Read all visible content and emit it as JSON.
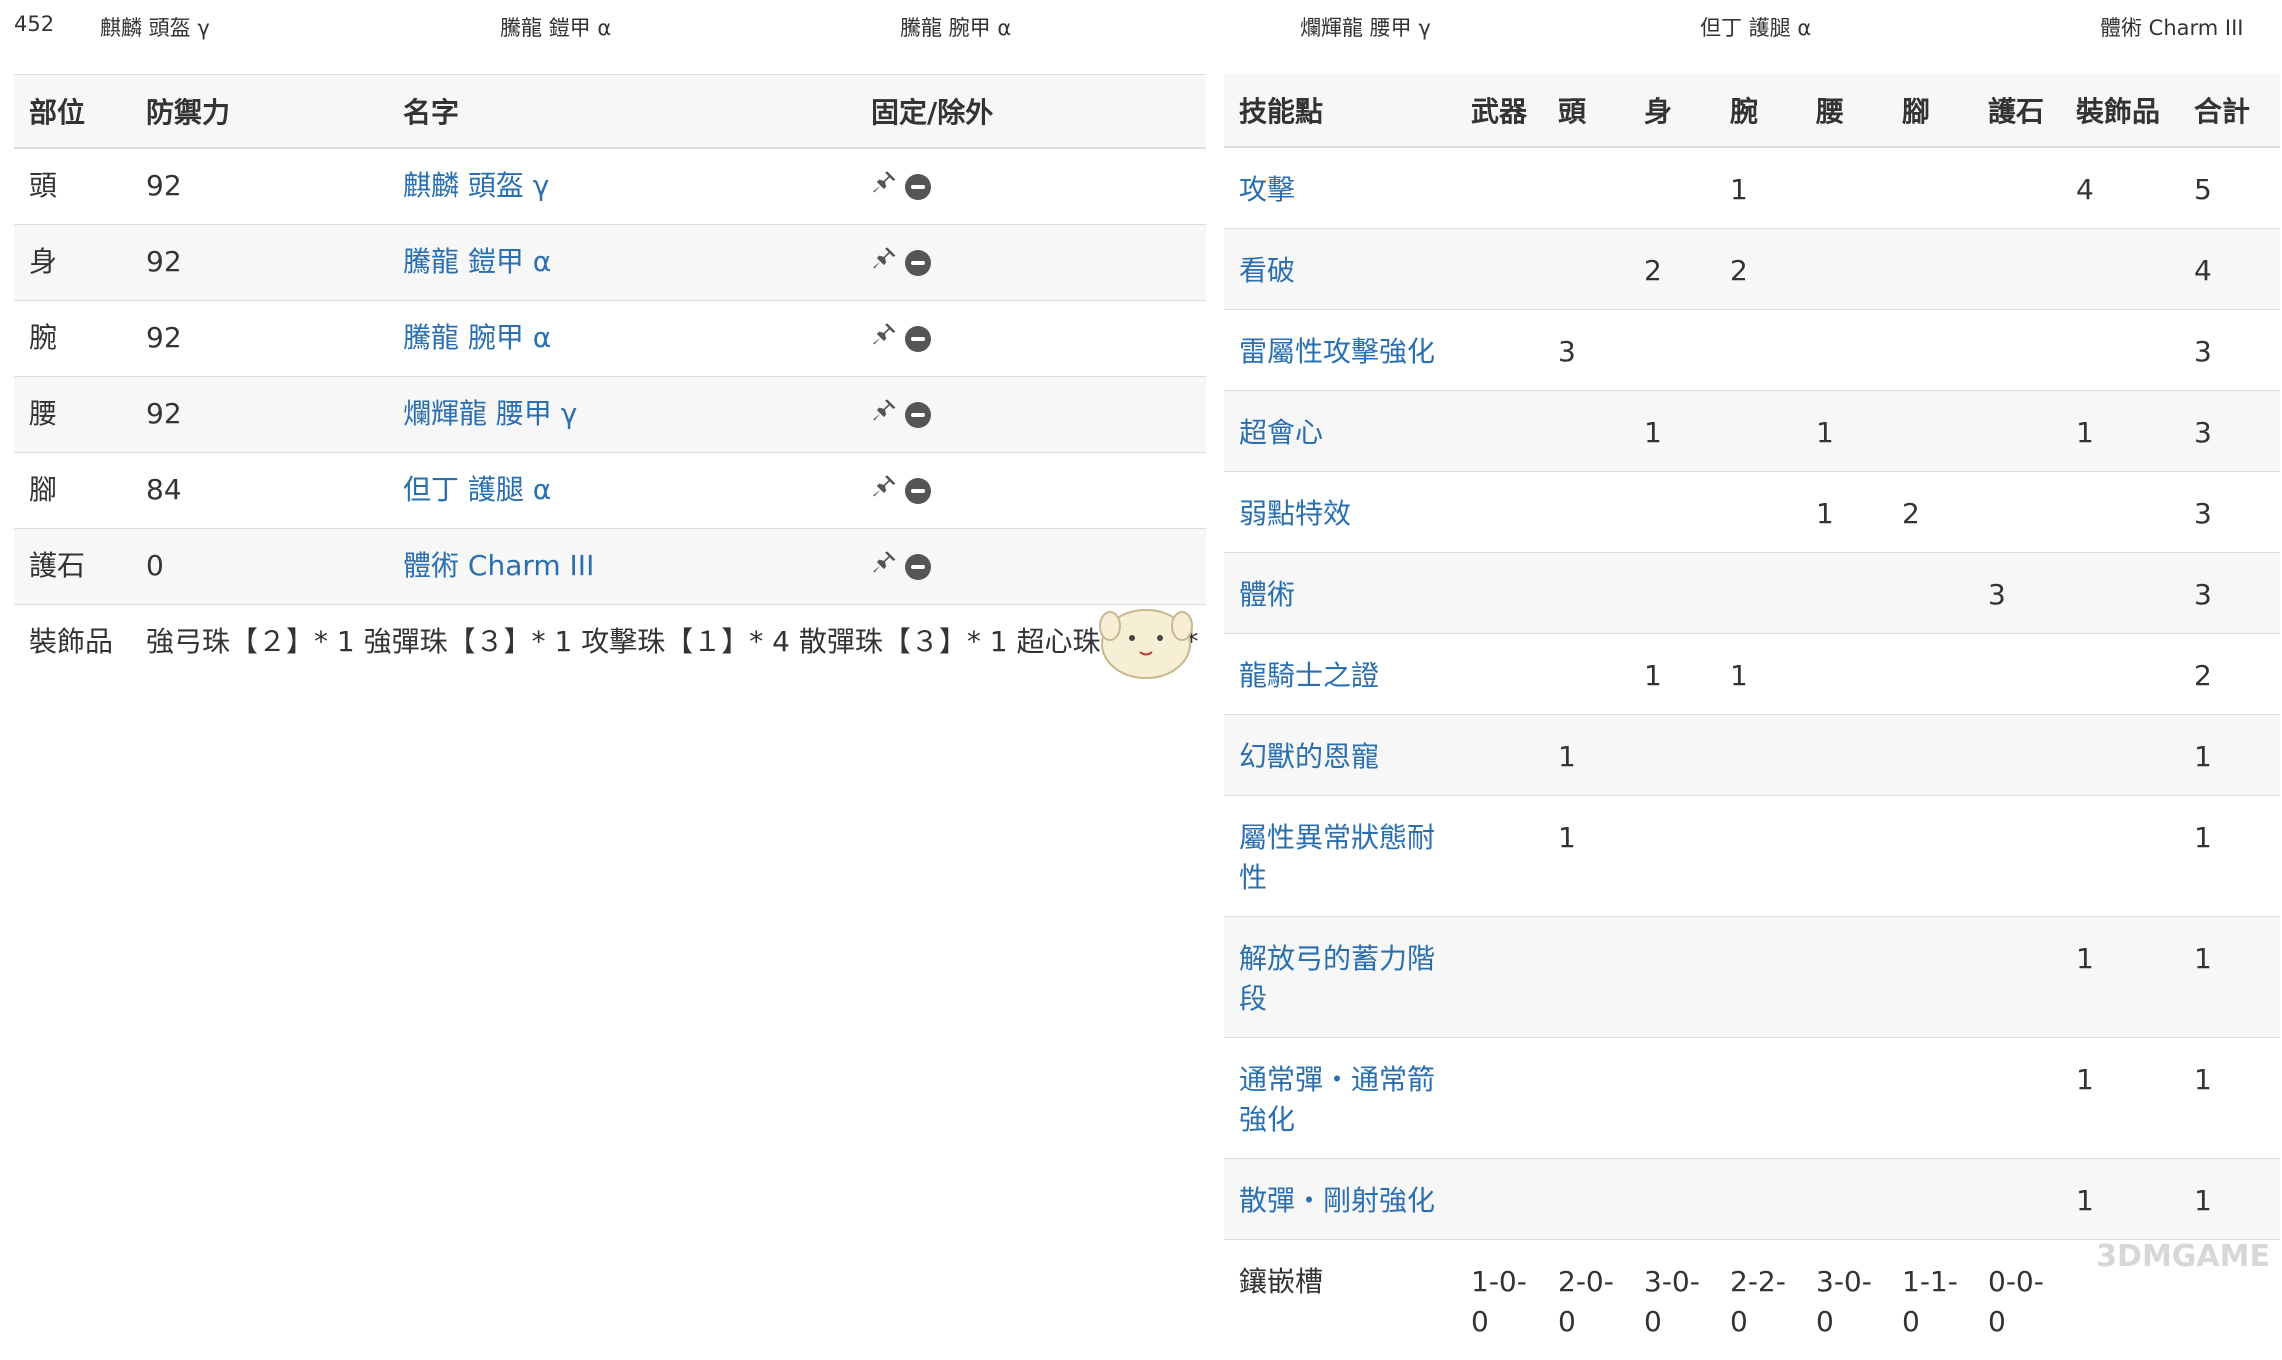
{
  "top_bar": {
    "score": "452",
    "pieces": [
      "麒麟 頭盔 γ",
      "騰龍 鎧甲 α",
      "騰龍 腕甲 α",
      "爛輝龍 腰甲 γ",
      "但丁 護腿 α",
      "體術 Charm III"
    ]
  },
  "equipment": {
    "headers": [
      "部位",
      "防禦力",
      "名字",
      "固定/除外"
    ],
    "rows": [
      {
        "slot": "頭",
        "defense": "92",
        "name": "麒麟 頭盔 γ"
      },
      {
        "slot": "身",
        "defense": "92",
        "name": "騰龍 鎧甲 α"
      },
      {
        "slot": "腕",
        "defense": "92",
        "name": "騰龍 腕甲 α"
      },
      {
        "slot": "腰",
        "defense": "92",
        "name": "爛輝龍 腰甲 γ"
      },
      {
        "slot": "腳",
        "defense": "84",
        "name": "但丁 護腿 α"
      },
      {
        "slot": "護石",
        "defense": "0",
        "name": "體術 Charm III"
      }
    ],
    "decorations_label": "裝飾品",
    "decorations_value": "強弓珠【２】* 1 強彈珠【３】* 1 攻擊珠【１】* 4 散彈珠【３】* 1 超心珠【２】* 1"
  },
  "skills": {
    "headers": [
      "技能點",
      "武器",
      "頭",
      "身",
      "腕",
      "腰",
      "腳",
      "護石",
      "裝飾品",
      "合計"
    ],
    "rows": [
      {
        "skill": "攻擊",
        "values": [
          "",
          "",
          "",
          "1",
          "",
          "",
          "",
          "4",
          "5"
        ]
      },
      {
        "skill": "看破",
        "values": [
          "",
          "",
          "2",
          "2",
          "",
          "",
          "",
          "",
          "4"
        ]
      },
      {
        "skill": "雷屬性攻擊強化",
        "values": [
          "",
          "3",
          "",
          "",
          "",
          "",
          "",
          "",
          "3"
        ]
      },
      {
        "skill": "超會心",
        "values": [
          "",
          "",
          "1",
          "",
          "1",
          "",
          "",
          "1",
          "3"
        ]
      },
      {
        "skill": "弱點特效",
        "values": [
          "",
          "",
          "",
          "",
          "1",
          "2",
          "",
          "",
          "3"
        ]
      },
      {
        "skill": "體術",
        "values": [
          "",
          "",
          "",
          "",
          "",
          "",
          "3",
          "",
          "3"
        ]
      },
      {
        "skill": "龍騎士之證",
        "values": [
          "",
          "",
          "1",
          "1",
          "",
          "",
          "",
          "",
          "2"
        ]
      },
      {
        "skill": "幻獸的恩寵",
        "values": [
          "",
          "1",
          "",
          "",
          "",
          "",
          "",
          "",
          "1"
        ]
      },
      {
        "skill": "屬性異常狀態耐性",
        "values": [
          "",
          "1",
          "",
          "",
          "",
          "",
          "",
          "",
          "1"
        ]
      },
      {
        "skill": "解放弓的蓄力階段",
        "values": [
          "",
          "",
          "",
          "",
          "",
          "",
          "",
          "1",
          "1"
        ]
      },
      {
        "skill": "通常彈・通常箭強化",
        "values": [
          "",
          "",
          "",
          "",
          "",
          "",
          "",
          "1",
          "1"
        ]
      },
      {
        "skill": "散彈・剛射強化",
        "values": [
          "",
          "",
          "",
          "",
          "",
          "",
          "",
          "1",
          "1"
        ]
      }
    ],
    "slots_label": "鑲嵌槽",
    "slots_values": [
      "1-0-0",
      "2-0-0",
      "3-0-0",
      "2-2-0",
      "3-0-0",
      "1-1-0",
      "0-0-0",
      "",
      ""
    ]
  },
  "watermark": "3DMGAME",
  "icons": {
    "fix": "pin-icon",
    "exclude": "minus-circle-icon"
  },
  "colors": {
    "link": "#2a6fb0",
    "text": "#333333",
    "stripe": "#f7f7f7",
    "border": "#dddddd"
  }
}
